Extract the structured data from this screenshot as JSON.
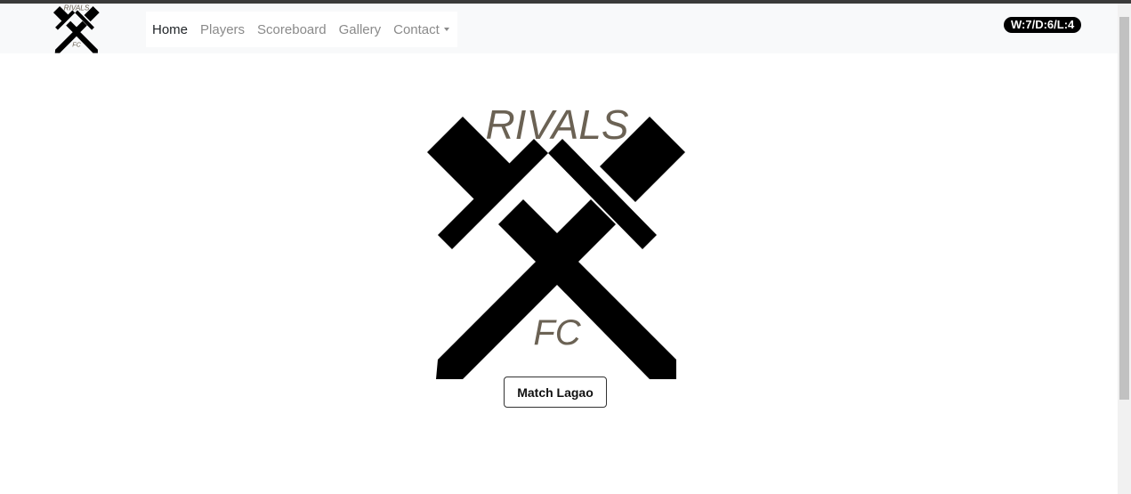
{
  "nav": {
    "logo_top": "RIVALS",
    "logo_bottom": "FC",
    "links": [
      {
        "label": "Home"
      },
      {
        "label": "Players"
      },
      {
        "label": "Scoreboard"
      },
      {
        "label": "Gallery"
      },
      {
        "label": "Contact"
      }
    ],
    "record": "W:7/D:6/L:4"
  },
  "hero": {
    "logo_top": "RIVALS",
    "logo_bottom": "FC",
    "button_label": "Match Lagao"
  },
  "colors": {
    "navbar_bg": "#f8f9fa",
    "badge_bg": "#000000",
    "badge_text": "#ffffff",
    "logo_text": "#6b6254",
    "active_link": "#212529",
    "inactive_link": "#8a8a8a"
  },
  "icons": {
    "dropdown": "caret-down"
  }
}
